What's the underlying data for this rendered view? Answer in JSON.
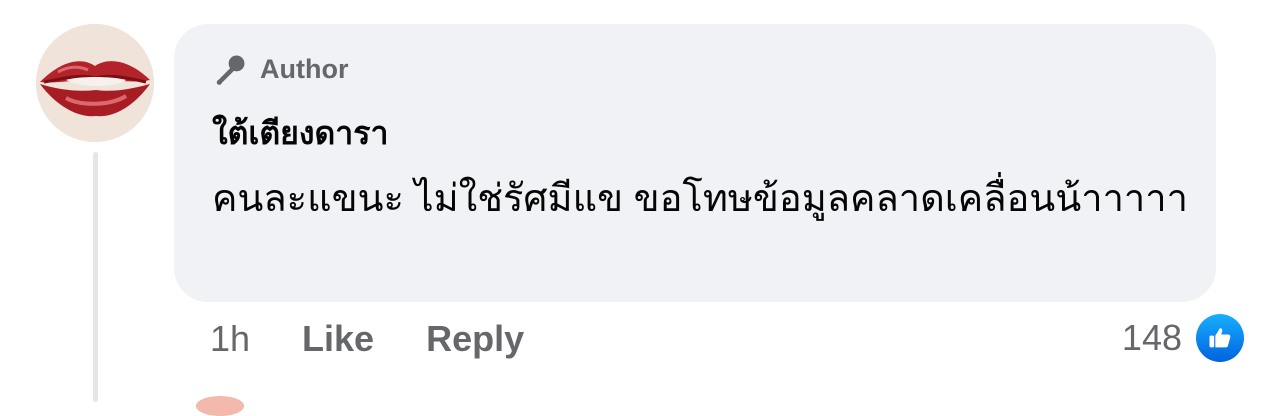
{
  "comment": {
    "badge_label": "Author",
    "badge_icon": "microphone-icon",
    "author_name": "ใต้เตียงดารา",
    "text": "คนละแขนะ ไม่ใช่รัศมีแข ขอโทษข้อมูลคลาดเคลื่อนน้าาาาา",
    "time": "1h",
    "like_label": "Like",
    "reply_label": "Reply",
    "reaction_count": "148",
    "reaction_icon": "like-thumb-icon"
  },
  "colors": {
    "bubble": "#f0f2f5",
    "secondary_text": "#65676b",
    "primary_text": "#050505",
    "like_blue": "#0866ff"
  }
}
